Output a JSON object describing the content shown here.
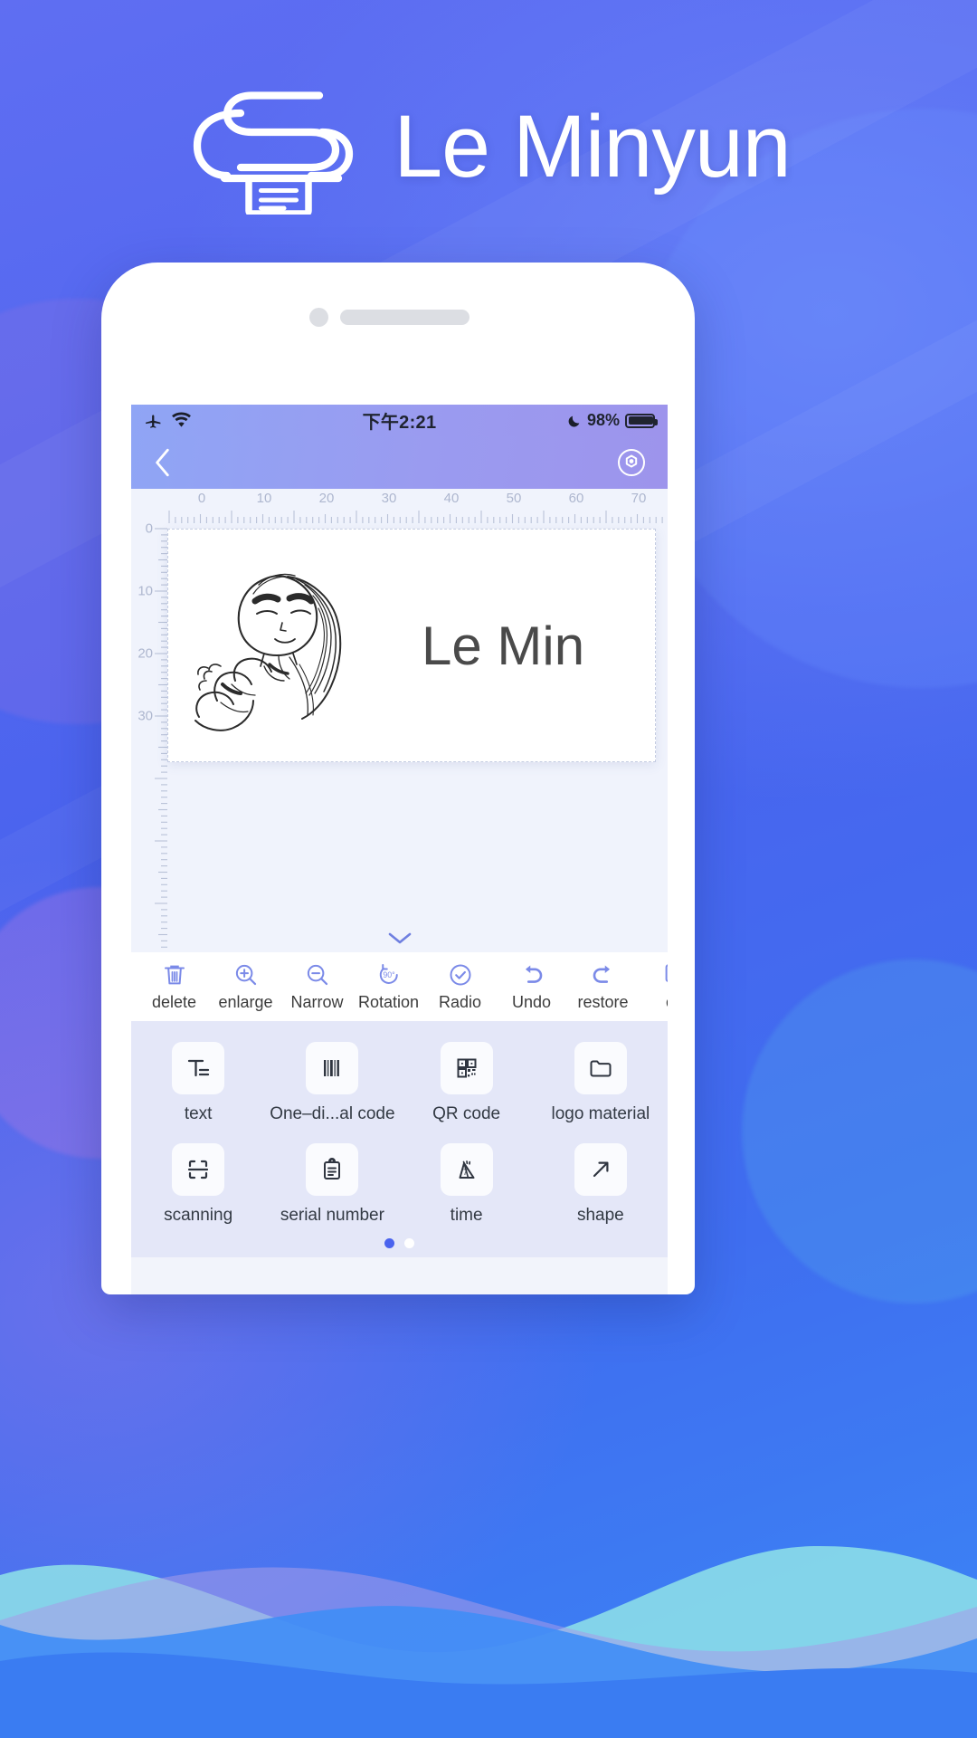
{
  "brand": {
    "app_title": "Le Minyun",
    "logo_icon": "cloud-printer-icon",
    "accent_color": "#4a63ee",
    "background_color": "#4a63ee"
  },
  "phone": {
    "status_bar": {
      "airplane_icon": "airplane-icon",
      "wifi_icon": "wifi-icon",
      "time": "下午2:21",
      "moon_icon": "crescent-moon-icon",
      "battery_percent": "98%",
      "battery_icon": "battery-full-icon"
    },
    "nav_bar": {
      "back_icon": "chevron-left-icon",
      "settings_icon": "gear-icon"
    },
    "editor": {
      "ruler_horizontal": [
        "0",
        "10",
        "20",
        "30",
        "40",
        "50",
        "60",
        "70"
      ],
      "ruler_vertical": [
        "0",
        "10",
        "20",
        "30"
      ],
      "label_text": "Le Min",
      "label_image_icon": "anime-girl-sketch",
      "collapse_icon": "chevron-down-icon"
    },
    "toolbar": [
      {
        "label": "delete",
        "icon": "trash-icon"
      },
      {
        "label": "enlarge",
        "icon": "zoom-in-icon"
      },
      {
        "label": "Narrow",
        "icon": "zoom-out-icon"
      },
      {
        "label": "Rotation",
        "icon": "rotate-90-icon"
      },
      {
        "label": "Radio",
        "icon": "check-circle-icon"
      },
      {
        "label": "Undo",
        "icon": "undo-arrow-icon"
      },
      {
        "label": "restore",
        "icon": "redo-arrow-icon"
      },
      {
        "label": "co",
        "icon": "copy-icon"
      }
    ],
    "widgets": {
      "row1": [
        {
          "label": "text",
          "icon": "text-tool-icon"
        },
        {
          "label": "One–di...al code",
          "icon": "barcode-icon"
        },
        {
          "label": "QR code",
          "icon": "qr-code-icon"
        },
        {
          "label": "logo material",
          "icon": "folder-icon"
        }
      ],
      "row2": [
        {
          "label": "scanning",
          "icon": "scan-frame-icon"
        },
        {
          "label": "serial number",
          "icon": "clipboard-icon"
        },
        {
          "label": "time",
          "icon": "calendar-icon"
        },
        {
          "label": "shape",
          "icon": "arrow-up-right-icon"
        }
      ],
      "page_dots": {
        "count": 2,
        "active_index": 0
      }
    }
  }
}
